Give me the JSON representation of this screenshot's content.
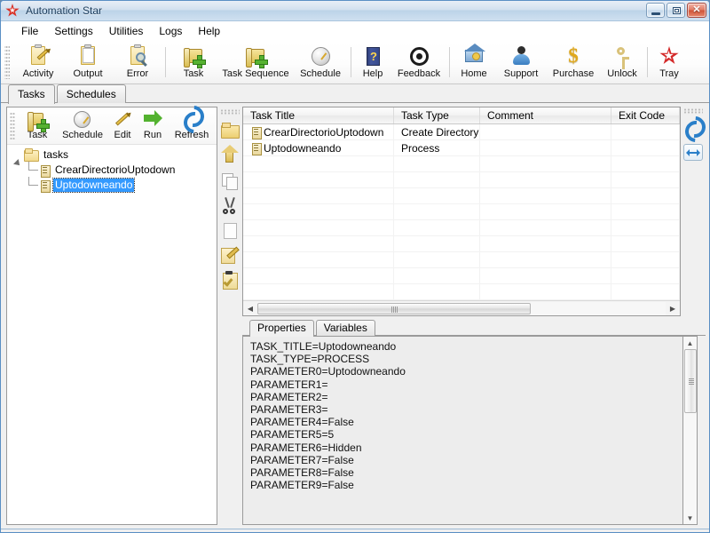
{
  "window": {
    "title": "Automation Star",
    "icon": "red-star-icon",
    "controls": {
      "minimize": "minimize-button",
      "maximize": "maximize-button",
      "close": "close-button",
      "close_glyph": "✕"
    }
  },
  "menubar": {
    "items": [
      {
        "label": "File"
      },
      {
        "label": "Settings"
      },
      {
        "label": "Utilities"
      },
      {
        "label": "Logs"
      },
      {
        "label": "Help"
      }
    ]
  },
  "toolbar": {
    "buttons": [
      {
        "label": "Activity",
        "icon": "activity-clipboard-pencil-icon"
      },
      {
        "label": "Output",
        "icon": "output-clipboard-icon"
      },
      {
        "label": "Error",
        "icon": "error-clipboard-magnifier-icon"
      },
      {
        "label": "Task",
        "icon": "task-scroll-plus-icon"
      },
      {
        "label": "Task Sequence",
        "icon": "task-sequence-scroll-plus-icon"
      },
      {
        "label": "Schedule",
        "icon": "schedule-clock-icon"
      },
      {
        "label": "Help",
        "icon": "help-book-icon"
      },
      {
        "label": "Feedback",
        "icon": "feedback-target-icon"
      },
      {
        "label": "Home",
        "icon": "home-house-icon"
      },
      {
        "label": "Support",
        "icon": "support-person-icon"
      },
      {
        "label": "Purchase",
        "icon": "purchase-dollar-icon"
      },
      {
        "label": "Unlock",
        "icon": "unlock-key-icon"
      },
      {
        "label": "Tray",
        "icon": "tray-star-icon"
      }
    ]
  },
  "tabs": {
    "items": [
      {
        "label": "Tasks",
        "active": true
      },
      {
        "label": "Schedules",
        "active": false
      }
    ]
  },
  "left_panel": {
    "toolbar": [
      {
        "label": "Task",
        "icon": "task-scroll-plus-icon"
      },
      {
        "label": "Schedule",
        "icon": "schedule-clock-icon"
      },
      {
        "label": "Edit",
        "icon": "edit-pencil-icon"
      },
      {
        "label": "Run",
        "icon": "run-green-arrow-icon"
      },
      {
        "label": "Refresh",
        "icon": "refresh-blue-arrows-icon"
      }
    ],
    "tree": {
      "root": {
        "label": "tasks",
        "icon": "folder-open-icon",
        "expanded": true
      },
      "children": [
        {
          "label": "CrearDirectorioUptodown",
          "icon": "task-document-icon",
          "selected": false
        },
        {
          "label": "Uptodowneando",
          "icon": "task-document-icon",
          "selected": true
        }
      ]
    }
  },
  "side_toolbar": {
    "buttons": [
      {
        "icon": "folder-icon",
        "name": "new-folder-button"
      },
      {
        "icon": "up-arrow-icon",
        "name": "move-up-button"
      },
      {
        "icon": "copy-icon",
        "name": "copy-button"
      },
      {
        "icon": "scissors-icon",
        "name": "cut-button"
      },
      {
        "icon": "paste-page-icon",
        "name": "paste-button"
      },
      {
        "icon": "edit-pencil-icon",
        "name": "edit-button"
      },
      {
        "icon": "clipboard-check-icon",
        "name": "apply-button"
      }
    ]
  },
  "right_side_toolbar": {
    "buttons": [
      {
        "icon": "refresh-blue-arrows-icon",
        "name": "refresh-grid-button"
      },
      {
        "icon": "fit-width-arrows-icon",
        "name": "fit-columns-button"
      }
    ]
  },
  "task_grid": {
    "columns": [
      "Task Title",
      "Task Type",
      "Comment",
      "Exit Code"
    ],
    "rows": [
      {
        "task_title": "CrearDirectorioUptodown",
        "task_type": "Create Directory",
        "comment": "",
        "exit_code": ""
      },
      {
        "task_title": "Uptodowneando",
        "task_type": "Process",
        "comment": "",
        "exit_code": ""
      }
    ],
    "hscroll": {
      "left_arrow": "◀",
      "right_arrow": "▶"
    }
  },
  "properties": {
    "tabs": [
      {
        "label": "Properties",
        "active": true
      },
      {
        "label": "Variables",
        "active": false
      }
    ],
    "text": "TASK_TITLE=Uptodowneando\nTASK_TYPE=PROCESS\nPARAMETER0=Uptodowneando\nPARAMETER1=\nPARAMETER2=\nPARAMETER3=\nPARAMETER4=False\nPARAMETER5=5\nPARAMETER6=Hidden\nPARAMETER7=False\nPARAMETER8=False\nPARAMETER9=False",
    "scroll": {
      "up_arrow": "▲",
      "down_arrow": "▼"
    }
  },
  "colors": {
    "titlebar_text": "#1b3c5c",
    "selection": "#3399ff",
    "accent_blue": "#2a7fc9",
    "icon_gold": "#e0c55a",
    "close_red": "#cf5236"
  }
}
